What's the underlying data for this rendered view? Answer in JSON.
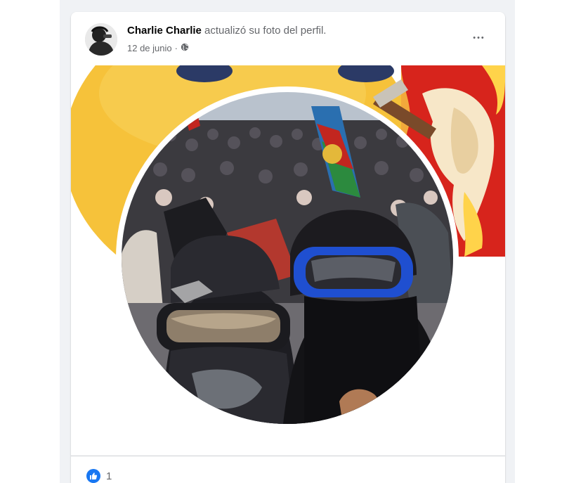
{
  "post": {
    "author": "Charlie Charlie",
    "action": "actualizó su foto del perfil.",
    "date": "12 de junio",
    "separator": "·",
    "privacy_icon": "globe-icon",
    "more_icon": "more-horizontal-icon",
    "more_label": "•••"
  },
  "reactions": {
    "icon": "like-icon",
    "count": "1"
  },
  "colors": {
    "feed_background": "#f0f2f5",
    "card": "#ffffff",
    "text_primary": "#050505",
    "text_secondary": "#65676b",
    "like_blue": "#1877f2",
    "cover_yellow": "#f6c23a",
    "cover_red": "#c8241b"
  }
}
